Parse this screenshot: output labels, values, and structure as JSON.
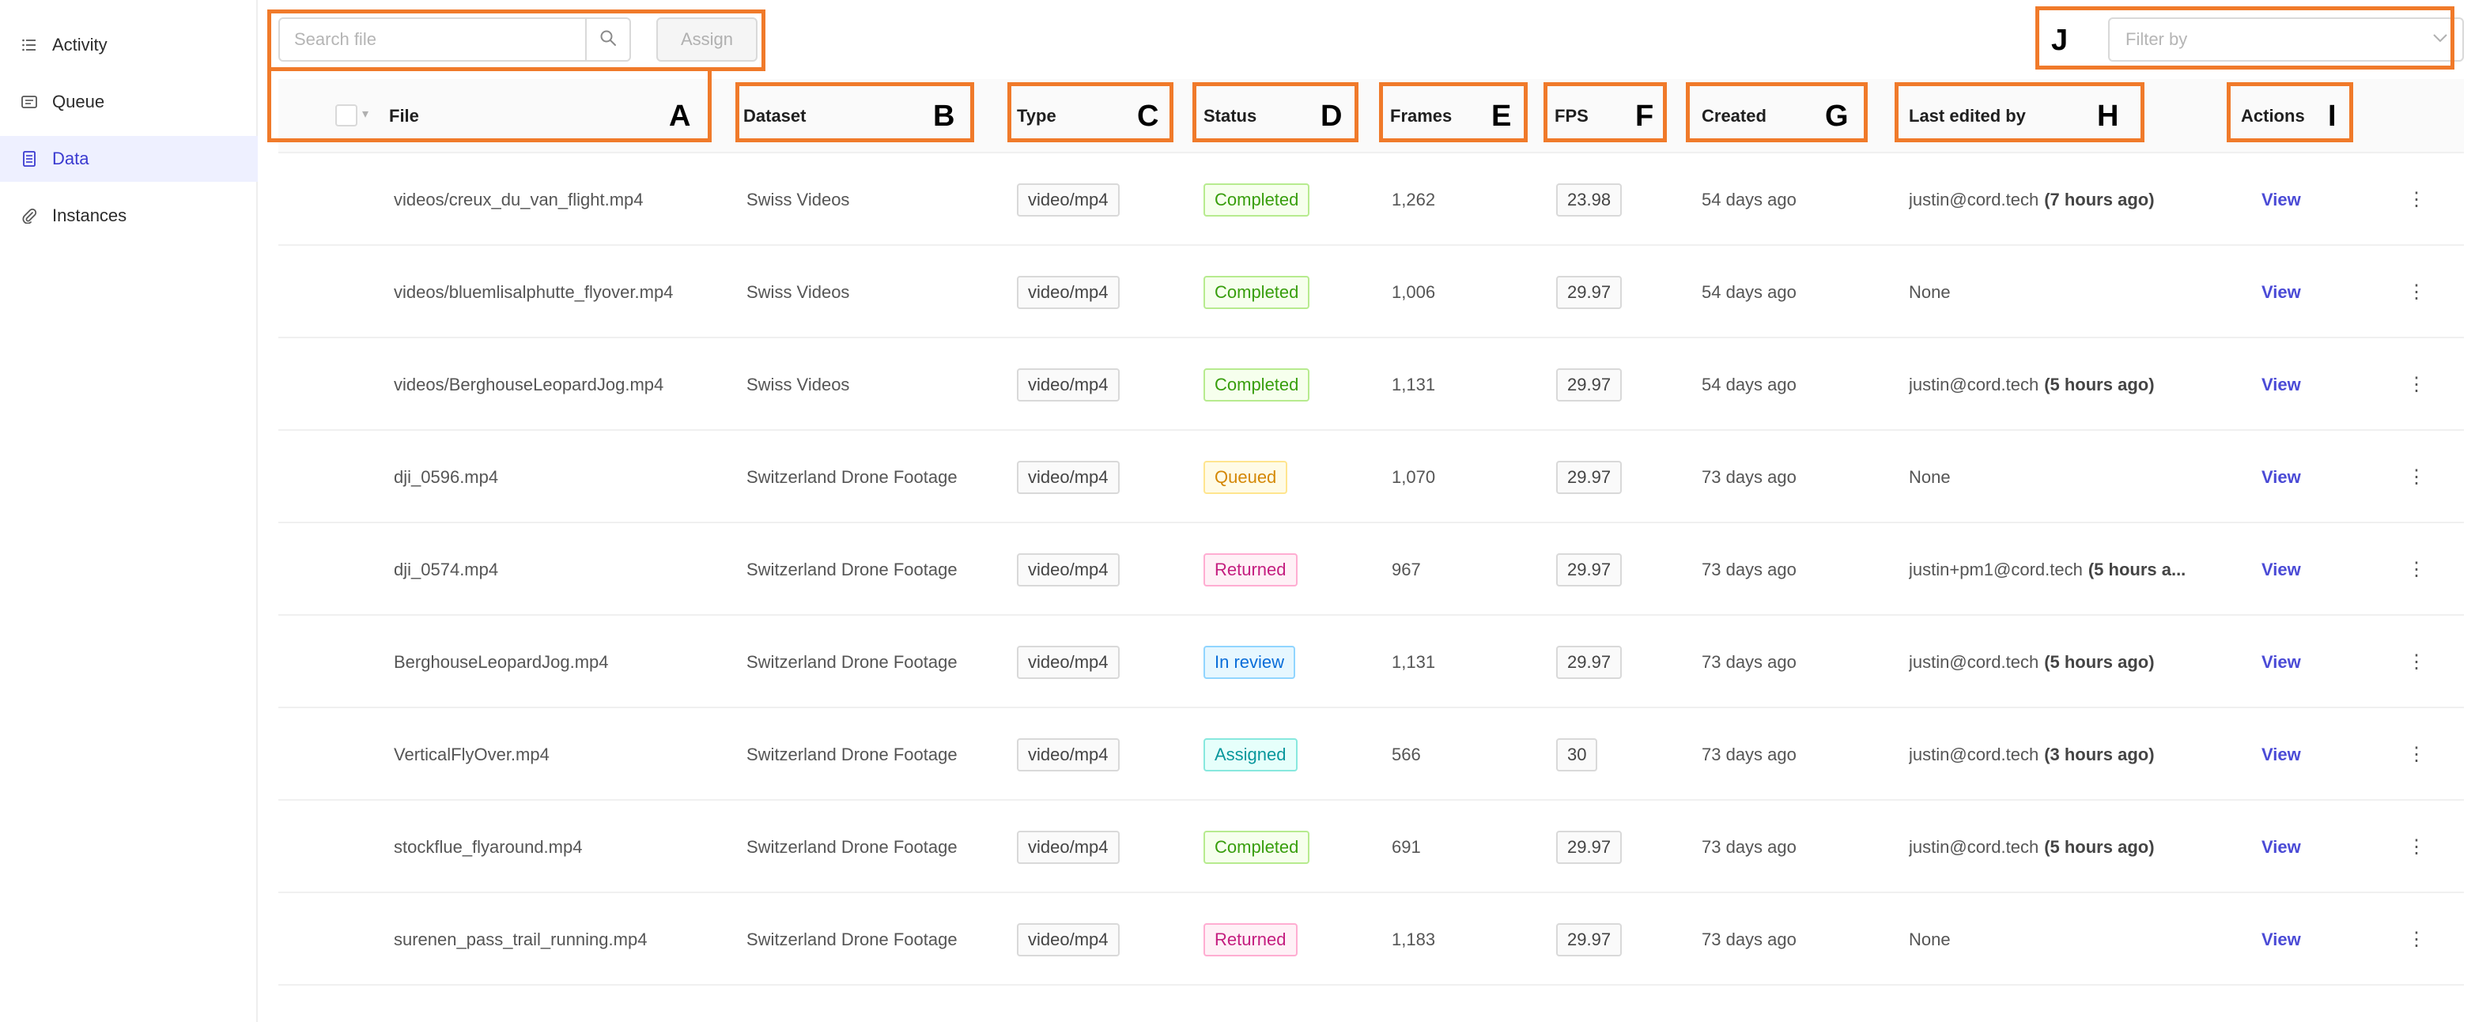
{
  "sidebar": {
    "items": [
      {
        "label": "Activity",
        "icon": "list-icon"
      },
      {
        "label": "Queue",
        "icon": "queue-icon"
      },
      {
        "label": "Data",
        "icon": "data-icon",
        "active": true
      },
      {
        "label": "Instances",
        "icon": "paperclip-icon"
      }
    ]
  },
  "toolbar": {
    "search_placeholder": "Search file",
    "assign_label": "Assign",
    "filter_placeholder": "Filter by"
  },
  "table": {
    "headers": {
      "file": "File",
      "dataset": "Dataset",
      "type": "Type",
      "status": "Status",
      "frames": "Frames",
      "fps": "FPS",
      "created": "Created",
      "last_edited": "Last edited by",
      "actions": "Actions"
    },
    "rows": [
      {
        "file": "videos/creux_du_van_flight.mp4",
        "dataset": "Swiss Videos",
        "type": "video/mp4",
        "status": "Completed",
        "frames": "1,262",
        "fps": "23.98",
        "created": "54 days ago",
        "edited_user": "justin@cord.tech",
        "edited_time": "(7 hours ago)",
        "action": "View"
      },
      {
        "file": "videos/bluemlisalphutte_flyover.mp4",
        "dataset": "Swiss Videos",
        "type": "video/mp4",
        "status": "Completed",
        "frames": "1,006",
        "fps": "29.97",
        "created": "54 days ago",
        "edited_user": "None",
        "edited_time": "",
        "action": "View"
      },
      {
        "file": "videos/BerghouseLeopardJog.mp4",
        "dataset": "Swiss Videos",
        "type": "video/mp4",
        "status": "Completed",
        "frames": "1,131",
        "fps": "29.97",
        "created": "54 days ago",
        "edited_user": "justin@cord.tech",
        "edited_time": "(5 hours ago)",
        "action": "View"
      },
      {
        "file": "dji_0596.mp4",
        "dataset": "Switzerland Drone Footage",
        "type": "video/mp4",
        "status": "Queued",
        "frames": "1,070",
        "fps": "29.97",
        "created": "73 days ago",
        "edited_user": "None",
        "edited_time": "",
        "action": "View"
      },
      {
        "file": "dji_0574.mp4",
        "dataset": "Switzerland Drone Footage",
        "type": "video/mp4",
        "status": "Returned",
        "frames": "967",
        "fps": "29.97",
        "created": "73 days ago",
        "edited_user": "justin+pm1@cord.tech",
        "edited_time": "(5 hours a...",
        "action": "View"
      },
      {
        "file": "BerghouseLeopardJog.mp4",
        "dataset": "Switzerland Drone Footage",
        "type": "video/mp4",
        "status": "In review",
        "frames": "1,131",
        "fps": "29.97",
        "created": "73 days ago",
        "edited_user": "justin@cord.tech",
        "edited_time": "(5 hours ago)",
        "action": "View"
      },
      {
        "file": "VerticalFlyOver.mp4",
        "dataset": "Switzerland Drone Footage",
        "type": "video/mp4",
        "status": "Assigned",
        "frames": "566",
        "fps": "30",
        "created": "73 days ago",
        "edited_user": "justin@cord.tech",
        "edited_time": "(3 hours ago)",
        "action": "View"
      },
      {
        "file": "stockflue_flyaround.mp4",
        "dataset": "Switzerland Drone Footage",
        "type": "video/mp4",
        "status": "Completed",
        "frames": "691",
        "fps": "29.97",
        "created": "73 days ago",
        "edited_user": "justin@cord.tech",
        "edited_time": "(5 hours ago)",
        "action": "View"
      },
      {
        "file": "surenen_pass_trail_running.mp4",
        "dataset": "Switzerland Drone Footage",
        "type": "video/mp4",
        "status": "Returned",
        "frames": "1,183",
        "fps": "29.97",
        "created": "73 days ago",
        "edited_user": "None",
        "edited_time": "",
        "action": "View"
      }
    ]
  },
  "annotations": {
    "labels": [
      "A",
      "B",
      "C",
      "D",
      "E",
      "F",
      "G",
      "H",
      "I",
      "J"
    ],
    "color": "#f07a2a"
  },
  "status_colors": {
    "Completed": "#389e0d",
    "Queued": "#d48806",
    "Returned": "#c41d7f",
    "In review": "#096dd9",
    "Assigned": "#08979c"
  },
  "accent_color": "#4b4bd6"
}
